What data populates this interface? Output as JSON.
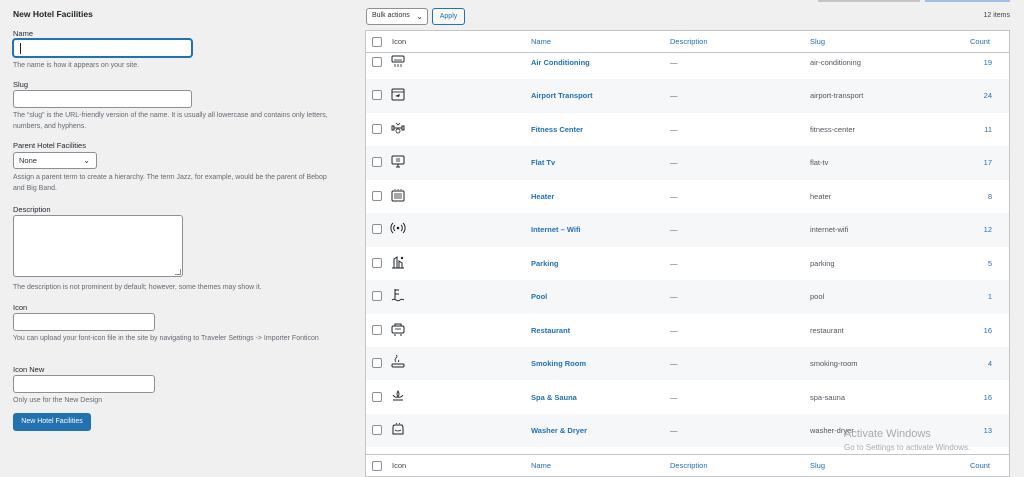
{
  "form": {
    "title": "New Hotel Facilities",
    "name_label": "Name",
    "name_value": "",
    "name_help": "The name is how it appears on your site.",
    "slug_label": "Slug",
    "slug_help": "The “slug” is the URL-friendly version of the name. It is usually all lowercase and contains only letters, numbers, and hyphens.",
    "parent_label": "Parent Hotel Facilities",
    "parent_value": "None",
    "parent_help": "Assign a parent term to create a hierarchy. The term Jazz, for example, would be the parent of Bebop and Big Band.",
    "description_label": "Description",
    "description_help": "The description is not prominent by default; however, some themes may show it.",
    "icon_label": "Icon",
    "icon_help": "You can upload your font-icon file in the site by navigating to Traveler Settings -> Importer Fonticon",
    "icon_new_label": "Icon New",
    "icon_new_help": "Only use for the New Design",
    "submit_label": "New Hotel Facilities"
  },
  "toolbar": {
    "bulk_actions": "Bulk actions",
    "apply": "Apply",
    "items_count": "12 items"
  },
  "table": {
    "headers": {
      "icon": "Icon",
      "name": "Name",
      "description": "Description",
      "slug": "Slug",
      "count": "Count"
    },
    "rows": [
      {
        "icon": "air-conditioner-icon",
        "name": "Air Conditioning",
        "description": "—",
        "slug": "air-conditioning",
        "count": "19"
      },
      {
        "icon": "airport-transport-icon",
        "name": "Airport Transport",
        "description": "—",
        "slug": "airport-transport",
        "count": "24"
      },
      {
        "icon": "fitness-icon",
        "name": "Fitness Center",
        "description": "—",
        "slug": "fitness-center",
        "count": "11"
      },
      {
        "icon": "tv-icon",
        "name": "Flat Tv",
        "description": "—",
        "slug": "flat-tv",
        "count": "17"
      },
      {
        "icon": "heater-icon",
        "name": "Heater",
        "description": "—",
        "slug": "heater",
        "count": "8"
      },
      {
        "icon": "wifi-icon",
        "name": "Internet – Wifi",
        "description": "—",
        "slug": "internet-wifi",
        "count": "12"
      },
      {
        "icon": "parking-icon",
        "name": "Parking",
        "description": "—",
        "slug": "parking",
        "count": "5"
      },
      {
        "icon": "pool-icon",
        "name": "Pool",
        "description": "—",
        "slug": "pool",
        "count": "1"
      },
      {
        "icon": "restaurant-icon",
        "name": "Restaurant",
        "description": "—",
        "slug": "restaurant",
        "count": "16"
      },
      {
        "icon": "smoking-icon",
        "name": "Smoking Room",
        "description": "—",
        "slug": "smoking-room",
        "count": "4"
      },
      {
        "icon": "spa-icon",
        "name": "Spa & Sauna",
        "description": "—",
        "slug": "spa-sauna",
        "count": "16"
      },
      {
        "icon": "washer-icon",
        "name": "Washer & Dryer",
        "description": "—",
        "slug": "washer-dryer",
        "count": "13"
      }
    ]
  },
  "watermark": {
    "line1": "Activate Windows",
    "line2": "Go to Settings to activate Windows."
  }
}
